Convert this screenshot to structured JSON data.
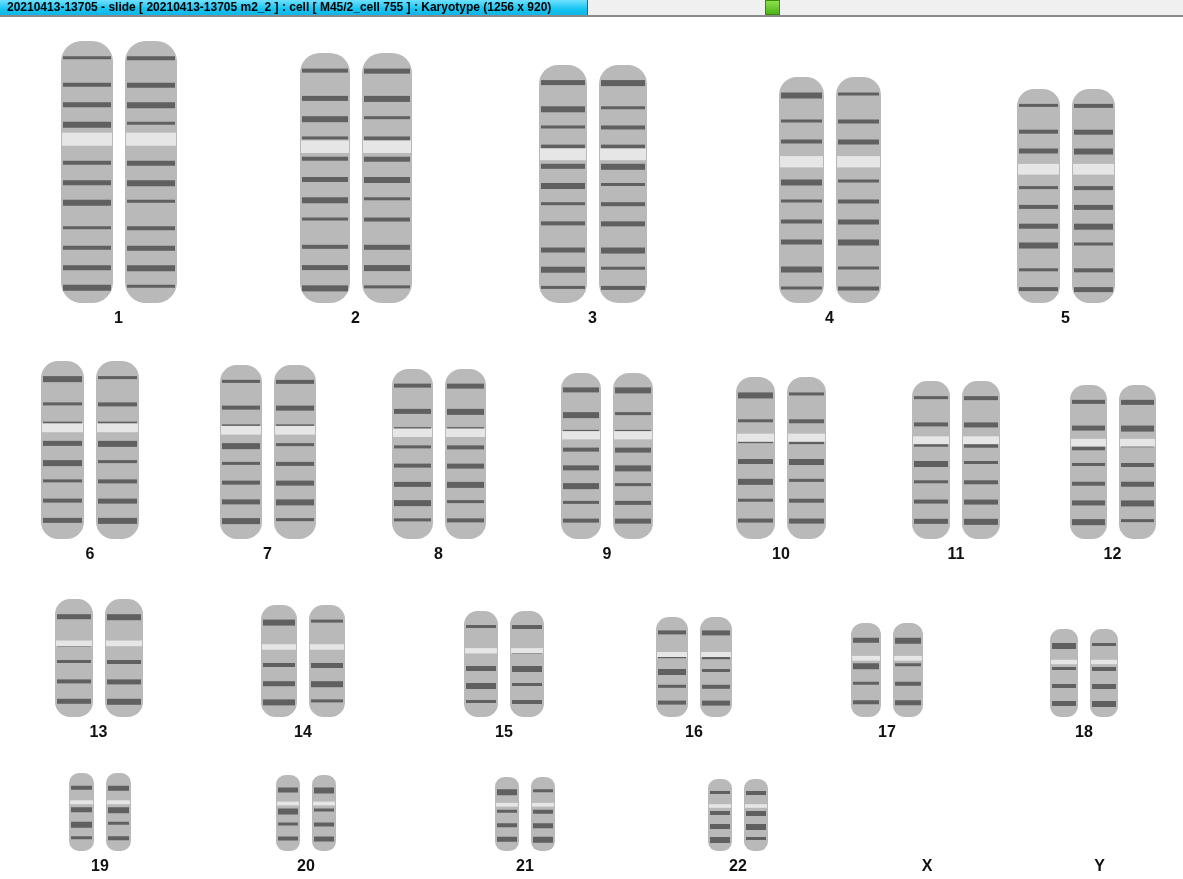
{
  "window": {
    "title": "20210413-13705 - slide [ 20210413-13705 m2_2 ] : cell [ M45/2_cell 755 ] : Karyotype  (1256 x 920)"
  },
  "karyotype": {
    "rows": [
      {
        "pairs": [
          {
            "label": "1",
            "kind": "pair"
          },
          {
            "label": "2",
            "kind": "pair"
          },
          {
            "label": "3",
            "kind": "pair"
          },
          {
            "label": "4",
            "kind": "pair"
          },
          {
            "label": "5",
            "kind": "pair"
          }
        ]
      },
      {
        "pairs": [
          {
            "label": "6",
            "kind": "pair"
          },
          {
            "label": "7",
            "kind": "pair"
          },
          {
            "label": "8",
            "kind": "pair"
          },
          {
            "label": "9",
            "kind": "pair"
          },
          {
            "label": "10",
            "kind": "pair"
          },
          {
            "label": "11",
            "kind": "pair"
          },
          {
            "label": "12",
            "kind": "pair"
          }
        ]
      },
      {
        "pairs": [
          {
            "label": "13",
            "kind": "pair"
          },
          {
            "label": "14",
            "kind": "pair"
          },
          {
            "label": "15",
            "kind": "pair"
          },
          {
            "label": "16",
            "kind": "pair"
          },
          {
            "label": "17",
            "kind": "pair"
          },
          {
            "label": "18",
            "kind": "pair"
          }
        ]
      },
      {
        "pairs": [
          {
            "label": "19",
            "kind": "pair"
          },
          {
            "label": "20",
            "kind": "pair"
          },
          {
            "label": "21",
            "kind": "pair"
          },
          {
            "label": "22",
            "kind": "pair"
          },
          {
            "label": "X",
            "kind": "empty"
          },
          {
            "label": "Y",
            "kind": "empty"
          }
        ]
      }
    ]
  }
}
